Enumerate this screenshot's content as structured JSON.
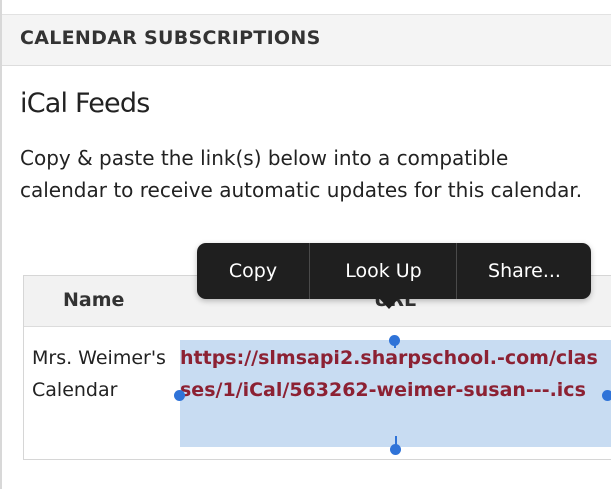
{
  "header": {
    "title": "CALENDAR SUBSCRIPTIONS"
  },
  "section": {
    "title": "iCal Feeds",
    "description": "Copy & paste the link(s) below into a compatible calendar to receive automatic updates for this calendar."
  },
  "table": {
    "columns": [
      "Name",
      "URL"
    ],
    "rows": [
      {
        "name": "Mrs. Weimer's Calendar",
        "url": "https://slmsapi2.sharpschool.-com/classes/1/iCal/563262-weimer-susan---.ics"
      }
    ]
  },
  "context_menu": {
    "items": [
      "Copy",
      "Look Up",
      "Share..."
    ]
  },
  "colors": {
    "link": "#8c2133",
    "selection": "#c8dcf2",
    "handle": "#2f73d8",
    "menu_bg": "#1f1f1f"
  }
}
